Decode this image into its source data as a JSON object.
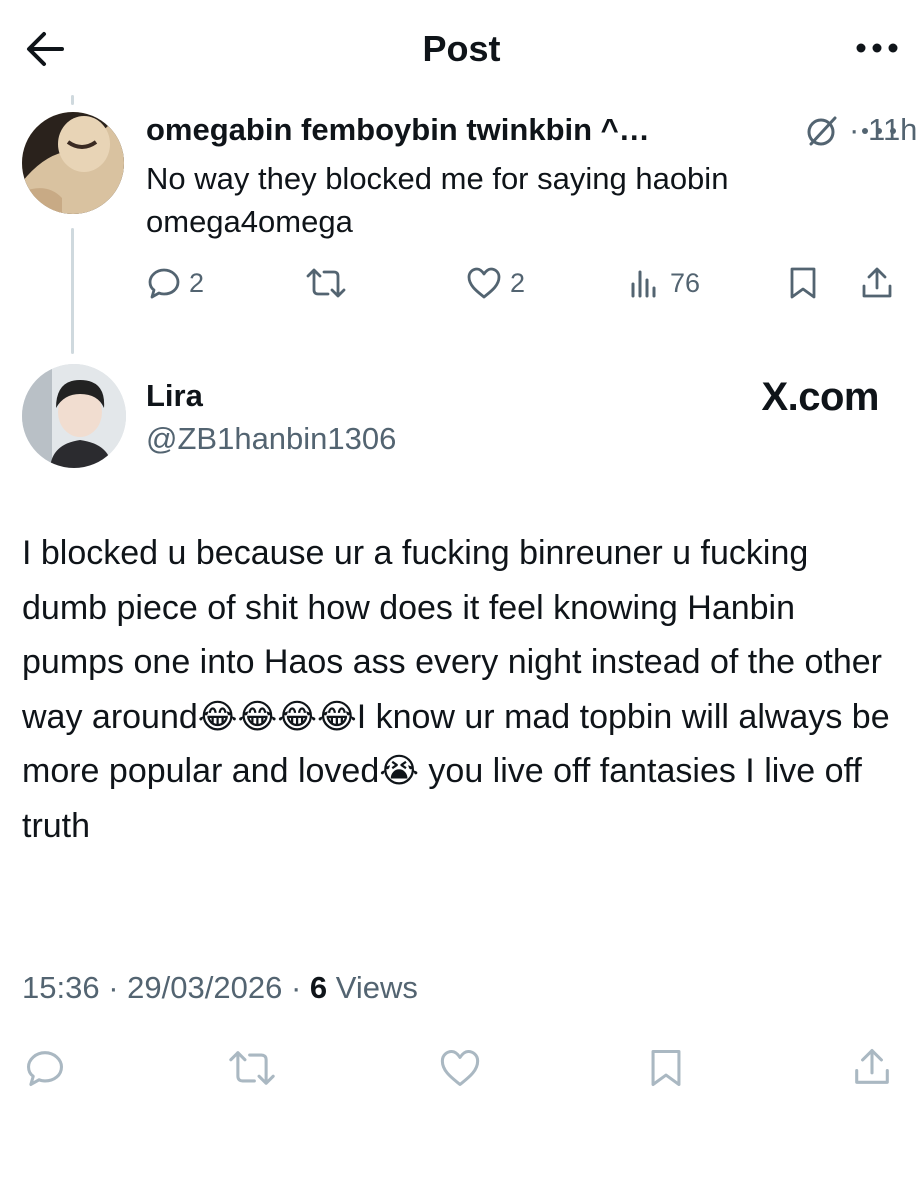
{
  "header": {
    "title": "Post",
    "back_icon": "arrow-left-icon",
    "more_icon": "more-horizontal-icon"
  },
  "parent_post": {
    "display_name": "omegabin femboybin twinkbin ^…",
    "separator": "·",
    "time": "11h",
    "text": "No way they blocked me for saying haobin omega4omega",
    "actions": {
      "replies": "2",
      "reposts": "",
      "likes": "2",
      "views": "76"
    }
  },
  "main_post": {
    "display_name": "Lira",
    "handle": "@ZB1hanbin1306",
    "watermark": "X.com",
    "text": "I blocked u because ur a fucking binreuner u fucking dumb piece of shit how does it feel knowing Hanbin pumps one into Haos ass every night instead of the other way around😂😂😂😂I know ur mad topbin will always be more popular and loved😭 you live off fantasies I live off truth",
    "time": "15:36",
    "date": "29/03/2026",
    "dot": "·",
    "views_count": "6",
    "views_label": "Views"
  },
  "colors": {
    "text_primary": "#0f1419",
    "text_secondary": "#536471",
    "thread_line": "#cfd9de",
    "icon_faded": "#aab8c2",
    "background": "#ffffff"
  }
}
